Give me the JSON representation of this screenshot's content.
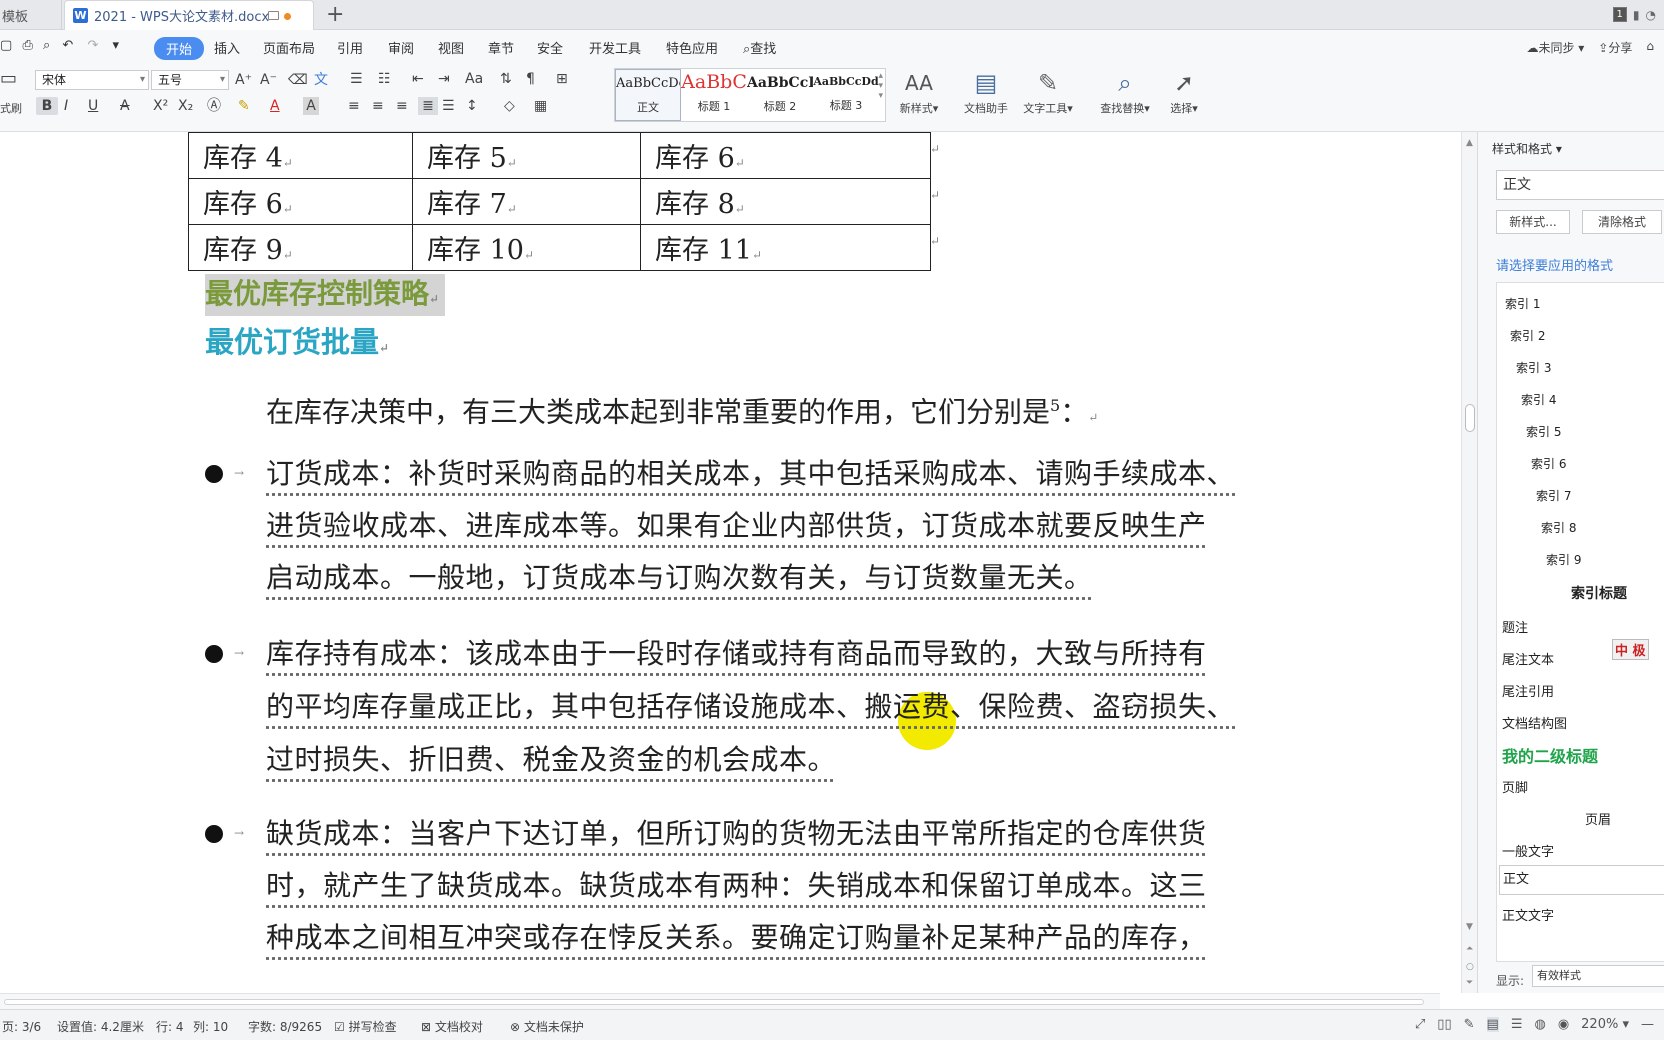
{
  "tabs": {
    "prev_tab": "模板",
    "active_tab": "2021 - WPS大论文素材.docx",
    "new_tab_symbol": "+",
    "window_badge": "1"
  },
  "menu": {
    "items": [
      "开始",
      "插入",
      "页面布局",
      "引用",
      "审阅",
      "视图",
      "章节",
      "安全",
      "开发工具",
      "特色应用",
      "查找"
    ],
    "sync": "未同步",
    "share": "分享"
  },
  "ribbon": {
    "font_name": "宋体",
    "font_size": "五号",
    "styles": [
      {
        "preview": "AaBbCcDc",
        "label": "正文"
      },
      {
        "preview": "AaBbC",
        "label": "标题 1"
      },
      {
        "preview": "AaBbCcI",
        "label": "标题 2"
      },
      {
        "preview": "AaBbCcDd",
        "label": "标题 3"
      }
    ],
    "new_style": "新样式",
    "doc_assistant": "文档助手",
    "text_tools": "文字工具",
    "find_replace": "查找替换",
    "select": "选择",
    "left_cut_label": "式刷",
    "accent_color": "#4a8cf0"
  },
  "table": {
    "rows": [
      [
        "库存 4",
        "库存 5",
        "库存 6"
      ],
      [
        "库存 6",
        "库存 7",
        "库存 8"
      ],
      [
        "库存 9",
        "库存 10",
        "库存 11"
      ]
    ]
  },
  "document": {
    "heading2": "最优库存控制策略",
    "heading3": "最优订货批量",
    "intro": "在库存决策中，有三大类成本起到非常重要的作用，它们分别是",
    "intro_footnote": "5",
    "intro_end": "：",
    "bullets": [
      {
        "lines": [
          "订货成本：补货时采购商品的相关成本，其中包括采购成本、请购手续成本、",
          "进货验收成本、进库成本等。如果有企业内部供货，订货成本就要反映生产",
          "启动成本。一般地，订货成本与订购次数有关，与订货数量无关。"
        ]
      },
      {
        "lines": [
          "库存持有成本：该成本由于一段时存储或持有商品而导致的，大致与所持有",
          "的平均库存量成正比，其中包括存储设施成本、搬运费、保险费、盗窃损失、",
          "过时损失、折旧费、税金及资金的机会成本。"
        ]
      },
      {
        "lines": [
          "缺货成本：当客户下达订单，但所订购的货物无法由平常所指定的仓库供货",
          "时，就产生了缺货成本。缺货成本有两种：失销成本和保留订单成本。这三",
          "种成本之间相互冲突或存在悖反关系。要确定订购量补足某种产品的库存，"
        ]
      }
    ],
    "heading2_color": "#7a9a3c",
    "heading3_color": "#2aa6c4",
    "highlight_color": "#f2ea00"
  },
  "panel": {
    "title": "样式和格式",
    "current_style": "正文",
    "new_style_btn": "新样式...",
    "clear_format_btn": "清除格式",
    "hint": "请选择要应用的格式",
    "items": [
      {
        "label": "索引 1"
      },
      {
        "label": "索引 2"
      },
      {
        "label": "索引 3"
      },
      {
        "label": "索引 4"
      },
      {
        "label": "索引 5"
      },
      {
        "label": "索引 6"
      },
      {
        "label": "索引 7"
      },
      {
        "label": "索引 8"
      },
      {
        "label": "索引 9"
      },
      {
        "label": "索引标题"
      },
      {
        "label": "题注"
      },
      {
        "label": "尾注文本"
      },
      {
        "label": "尾注引用"
      },
      {
        "label": "文档结构图"
      },
      {
        "label": "我的二级标题"
      },
      {
        "label": "页脚"
      },
      {
        "label": "页眉"
      },
      {
        "label": "一般文字"
      },
      {
        "label": "正文"
      },
      {
        "label": "正文文字"
      }
    ],
    "ime_badge": "中 极",
    "show_label": "显示:",
    "show_value": "有效样式"
  },
  "status": {
    "page": "页: 3/6",
    "setting": "设置值: 4.2厘米",
    "row": "行: 4",
    "col": "列: 10",
    "words": "字数: 8/9265",
    "spell": "拼写检查",
    "proof": "文档校对",
    "protect": "文档未保护",
    "zoom": "220%"
  }
}
